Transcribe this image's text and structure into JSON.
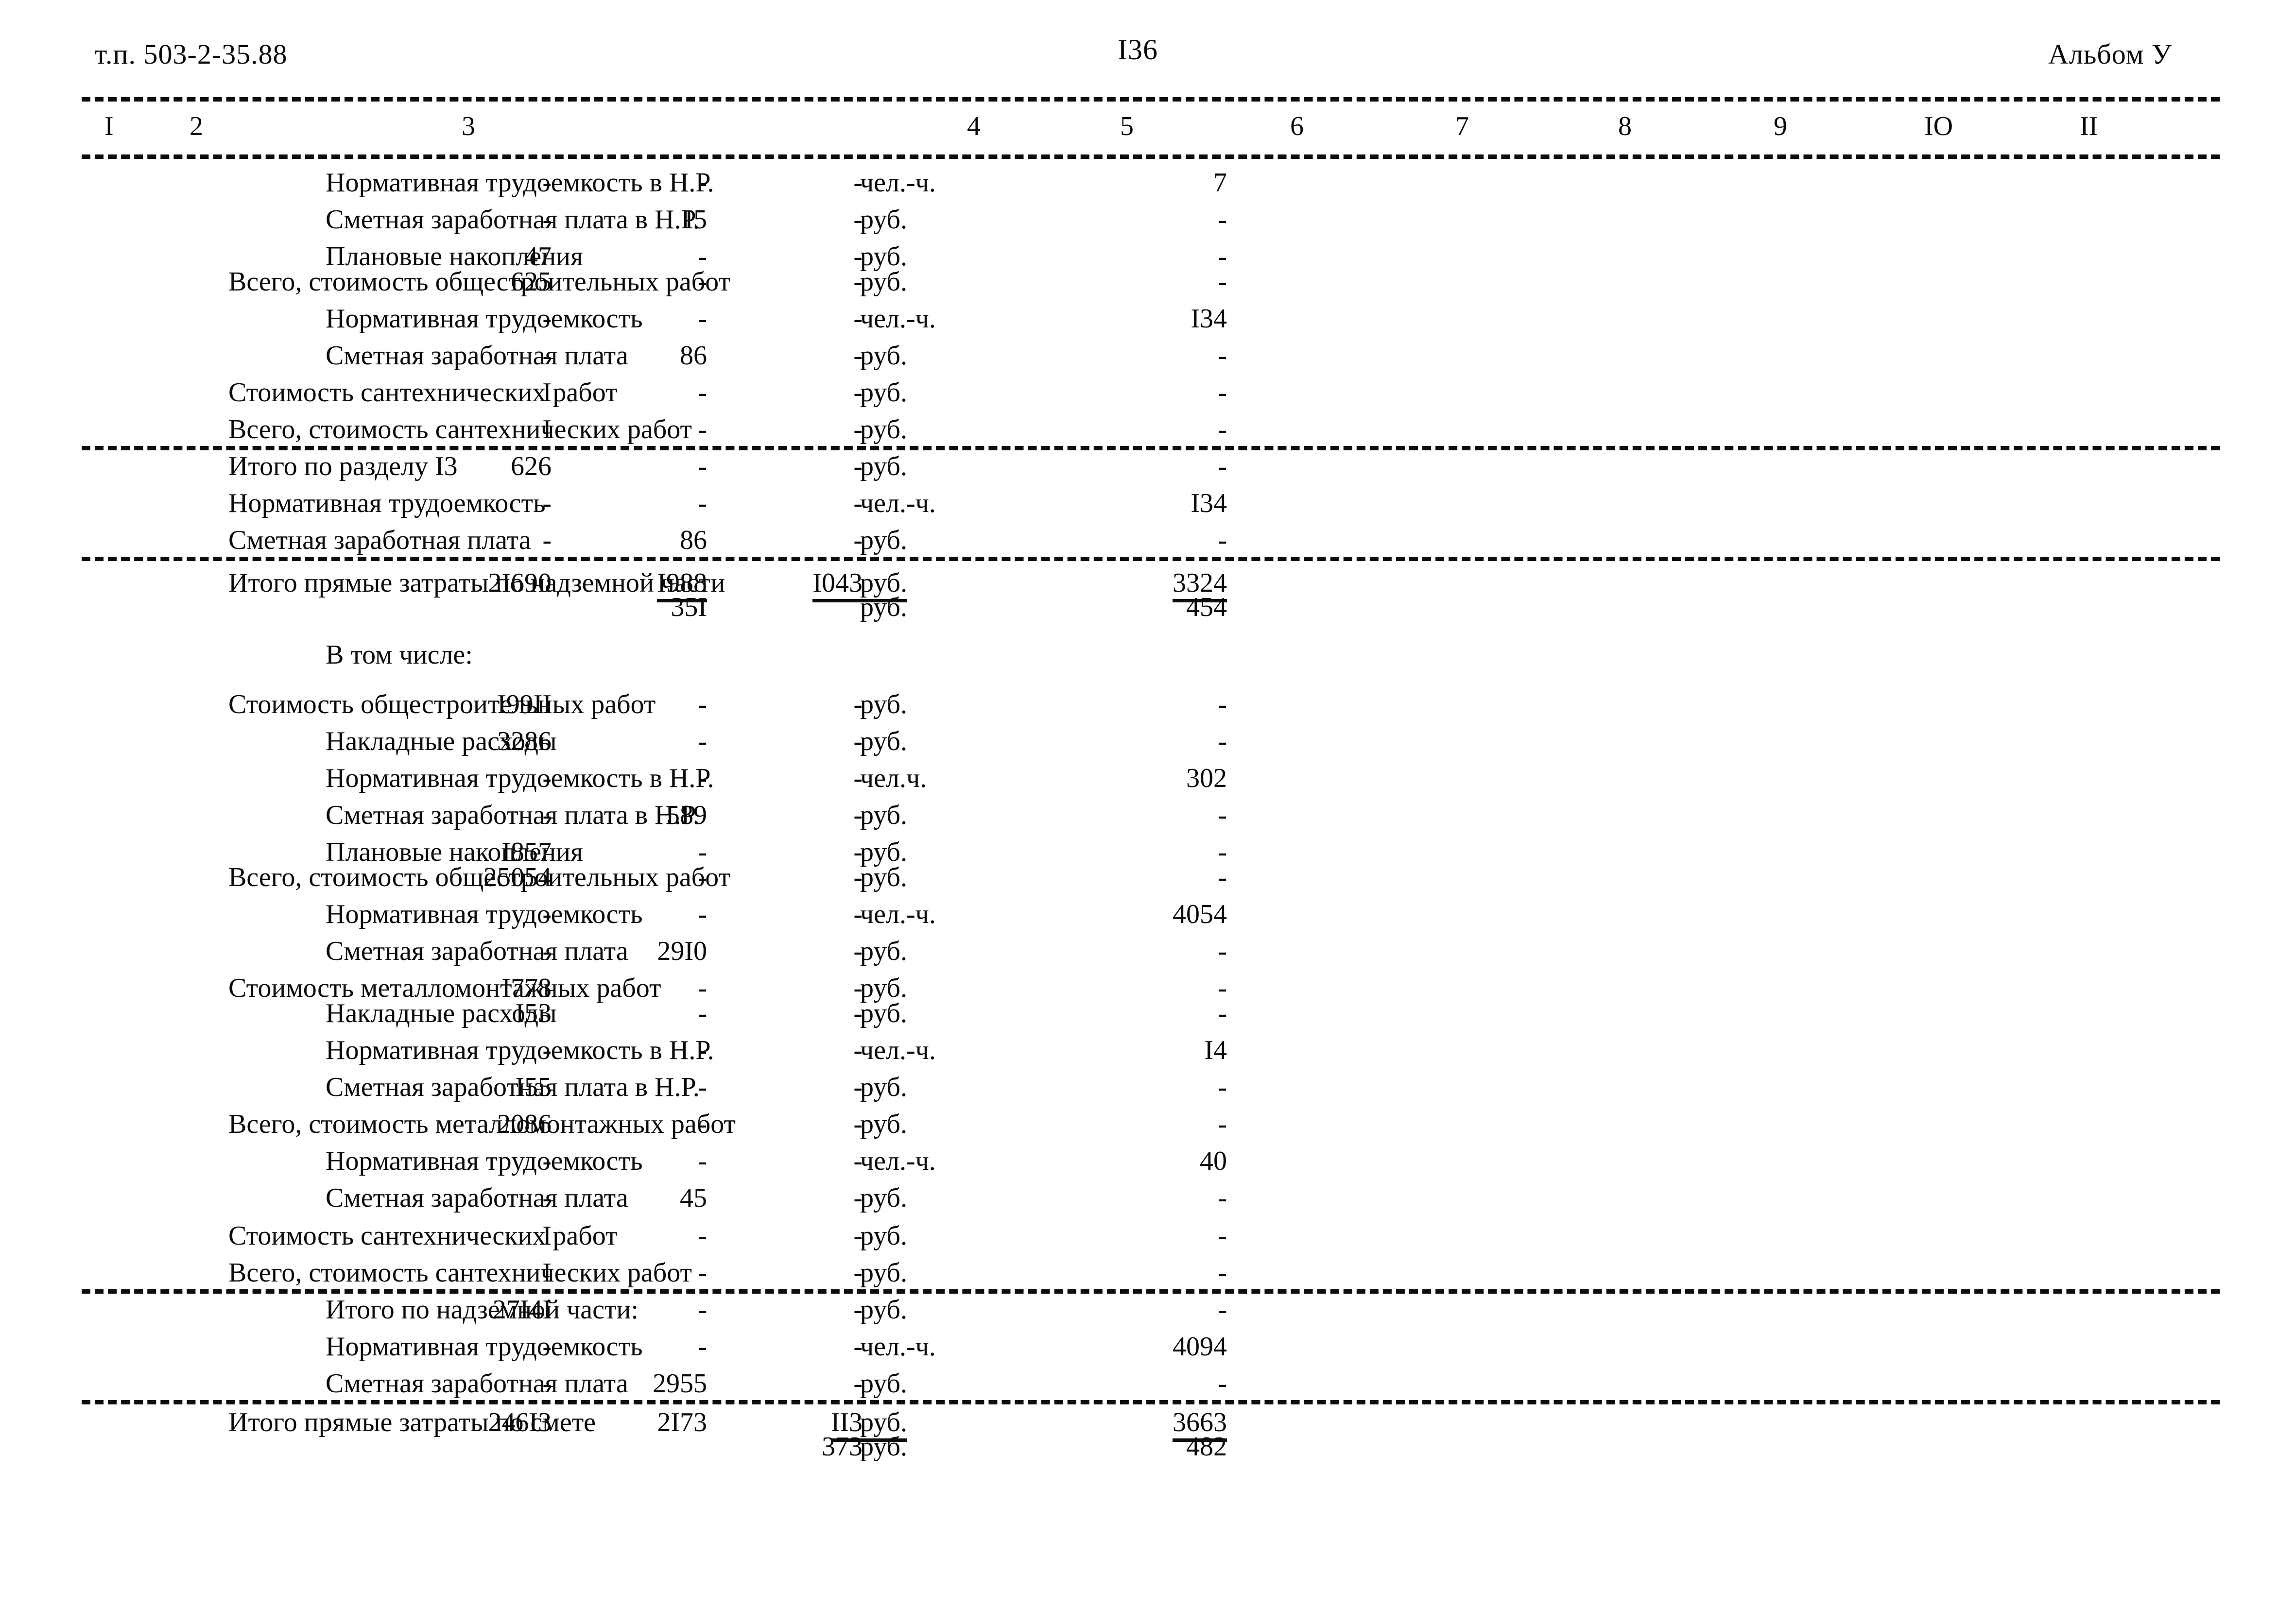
{
  "header": {
    "doc_code": "т.п. 503-2-35.88",
    "page_number": "I36",
    "album": "Альбом У"
  },
  "table": {
    "column_headers": [
      "I",
      "2",
      "3",
      "4",
      "5",
      "6",
      "7",
      "8",
      "9",
      "IO",
      "II"
    ],
    "rows": [
      {
        "indent": 2,
        "name": "Нормативная трудоемкость в Н.Р.",
        "unit": "чел.-ч.",
        "c7": "-",
        "c8": "-",
        "c9": "-",
        "c11": "7"
      },
      {
        "indent": 2,
        "name": "Сметная заработная плата в Н.Р.",
        "unit": "руб.",
        "c7": "-",
        "c8": "I5",
        "c9": "-",
        "c11": "-"
      },
      {
        "indent": 2,
        "name": "Плановые накопления",
        "unit": "руб.",
        "c7": "47",
        "c8": "-",
        "c9": "-",
        "c11": "-"
      },
      {
        "indent": 1,
        "name": "Всего, стоимость общестроительных работ",
        "unit": "руб.",
        "c7": "625",
        "c8": "-",
        "c9": "-",
        "c11": "-"
      },
      {
        "indent": 2,
        "name": "Нормативная трудоемкость",
        "unit": "чел.-ч.",
        "c7": "-",
        "c8": "-",
        "c9": "-",
        "c11": "I34"
      },
      {
        "indent": 2,
        "name": "Сметная заработная плата",
        "unit": "руб.",
        "c7": "-",
        "c8": "86",
        "c9": "-",
        "c11": "-"
      },
      {
        "indent": 1,
        "name": "Стоимость сантехнических работ",
        "unit": "руб.",
        "c7": "I",
        "c8": "-",
        "c9": "-",
        "c11": "-"
      },
      {
        "indent": 1,
        "name": "Всего, стоимость сантехнических работ",
        "unit": "руб.",
        "c7": "I",
        "c8": "-",
        "c9": "-",
        "c11": "-",
        "rule_after": true
      },
      {
        "indent": 1,
        "name": "Итого по разделу  I3",
        "unit": "руб.",
        "c7": "626",
        "c8": "-",
        "c9": "-",
        "c11": "-"
      },
      {
        "indent": 1,
        "name": "Нормативная трудоемкость",
        "unit": "чел.-ч.",
        "c7": "-",
        "c8": "-",
        "c9": "-",
        "c11": "I34"
      },
      {
        "indent": 1,
        "name": "Сметная заработная плата",
        "unit": "руб.",
        "c7": "-",
        "c8": "86",
        "c9": "-",
        "c11": "-",
        "rule_after": true
      },
      {
        "indent": 1,
        "name": "Итого прямые затраты по надземной части",
        "unit": "руб.",
        "unit_underline": true,
        "c7": "2I690",
        "c8": "I988",
        "c9": "I043",
        "c11": "3324",
        "underline": [
          "c8",
          "c9",
          "c11"
        ]
      },
      {
        "indent": 1,
        "name": "",
        "unit": "руб.",
        "c8": "35I",
        "c11": "454"
      },
      {
        "indent": 2,
        "name": "В том числе:",
        "unit": ""
      },
      {
        "indent": 1,
        "name": "Стоимость общестроительных работ",
        "unit": "руб.",
        "c7": "I99II",
        "c8": "-",
        "c9": "-",
        "c11": "-"
      },
      {
        "indent": 2,
        "name": "Накладные расходы",
        "unit": "руб.",
        "c7": "3286",
        "c8": "-",
        "c9": "-",
        "c11": "-"
      },
      {
        "indent": 2,
        "name": "Нормативная трудоемкость в Н.Р.",
        "unit": "чел.ч.",
        "c7": "-",
        "c8": "-",
        "c9": "-",
        "c11": "302"
      },
      {
        "indent": 2,
        "name": "Сметная заработная плата в Н.Р.",
        "unit": "руб.",
        "c7": "-",
        "c8": "589",
        "c9": "-",
        "c11": "-"
      },
      {
        "indent": 2,
        "name": "Плановые накопления",
        "unit": "руб.",
        "c7": "I857",
        "c8": "-",
        "c9": "-",
        "c11": "-"
      },
      {
        "indent": 1,
        "name": "Всего, стоимость общестроительных работ",
        "unit": "руб.",
        "c7": "25054",
        "c8": "-",
        "c9": "-",
        "c11": "-"
      },
      {
        "indent": 2,
        "name": "Нормативная трудоемкость",
        "unit": "чел.-ч.",
        "c7": "-",
        "c8": "-",
        "c9": "-",
        "c11": "4054"
      },
      {
        "indent": 2,
        "name": "Сметная заработная плата",
        "unit": "руб.",
        "c7": "-",
        "c8": "29I0",
        "c9": "-",
        "c11": "-"
      },
      {
        "indent": 1,
        "name": "Стоимость металломонтажных работ",
        "unit": "руб.",
        "c7": "I778",
        "c8": "-",
        "c9": "-",
        "c11": "-"
      },
      {
        "indent": 2,
        "name": "Накладные расходы",
        "unit": "руб.",
        "c7": "I53",
        "c8": "-",
        "c9": "-",
        "c11": "-"
      },
      {
        "indent": 2,
        "name": "Нормативная трудоемкость в Н.Р.",
        "unit": "чел.-ч.",
        "c7": "-",
        "c8": "-",
        "c9": "-",
        "c11": "I4"
      },
      {
        "indent": 2,
        "name": "Сметная заработная плата в Н.Р.",
        "unit": "руб.",
        "c7": "I55",
        "c8": "-",
        "c9": "-",
        "c11": "-"
      },
      {
        "indent": 1,
        "name": "Всего, стоимость металломонтажных работ",
        "unit": "руб.",
        "c7": "2086",
        "c8": "-",
        "c9": "-",
        "c11": "-"
      },
      {
        "indent": 2,
        "name": "Нормативная трудоемкость",
        "unit": "чел.-ч.",
        "c7": "-",
        "c8": "-",
        "c9": "-",
        "c11": "40"
      },
      {
        "indent": 2,
        "name": "Сметная заработная плата",
        "unit": "руб.",
        "c7": "-",
        "c8": "45",
        "c9": "-",
        "c11": "-"
      },
      {
        "indent": 1,
        "name": "Стоимость сантехнических работ",
        "unit": "руб.",
        "c7": "I",
        "c8": "-",
        "c9": "-",
        "c11": "-"
      },
      {
        "indent": 1,
        "name": "Всего, стоимость сантехнических работ",
        "unit": "руб.",
        "c7": "I",
        "c8": "-",
        "c9": "-",
        "c11": "-",
        "rule_after": true
      },
      {
        "indent": 2,
        "name": "Итого по надземной части:",
        "unit": "руб.",
        "c7": "27I4I",
        "c8": "-",
        "c9": "-",
        "c11": "-"
      },
      {
        "indent": 2,
        "name": "Нормативная трудоемкость",
        "unit": "чел.-ч.",
        "c7": "-",
        "c8": "-",
        "c9": "-",
        "c11": "4094"
      },
      {
        "indent": 2,
        "name": "Сметная заработная плата",
        "unit": "руб.",
        "c7": "-",
        "c8": "2955",
        "c9": "-",
        "c11": "-",
        "rule_after": true
      },
      {
        "indent": 1,
        "name": "Итого прямые затраты по смете",
        "unit": "руб.",
        "unit_underline": true,
        "c7": "246I3",
        "c8": "2I73",
        "c9": "II3",
        "c11": "3663",
        "underline": [
          "c9",
          "c11"
        ]
      },
      {
        "indent": 1,
        "name": "",
        "unit": "руб.",
        "c9": "373",
        "c11": "482"
      }
    ]
  }
}
